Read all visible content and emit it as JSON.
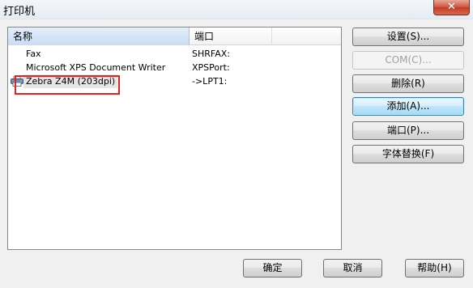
{
  "window": {
    "title": "打印机",
    "close_glyph": "✕"
  },
  "list": {
    "columns": [
      "名称",
      "端口",
      ""
    ],
    "rows": [
      {
        "name": "Fax",
        "port": "SHRFAX:"
      },
      {
        "name": "Microsoft XPS Document Writer",
        "port": "XPSPort:"
      },
      {
        "name": "Zebra Z4M (203dpi)",
        "port": "->LPT1:",
        "icon": "printer-icon"
      }
    ]
  },
  "side_buttons": {
    "settings": "设置(S)...",
    "com": "COM(C)...",
    "delete": "删除(R)",
    "add": "添加(A)...",
    "port": "端口(P)...",
    "font_replace": "字体替换(F)"
  },
  "bottom_buttons": {
    "ok": "确定",
    "cancel": "取消",
    "help": "帮助(H)"
  },
  "colors": {
    "annotation_box": "#e8201d",
    "selected_header": "#c9ddf3"
  }
}
